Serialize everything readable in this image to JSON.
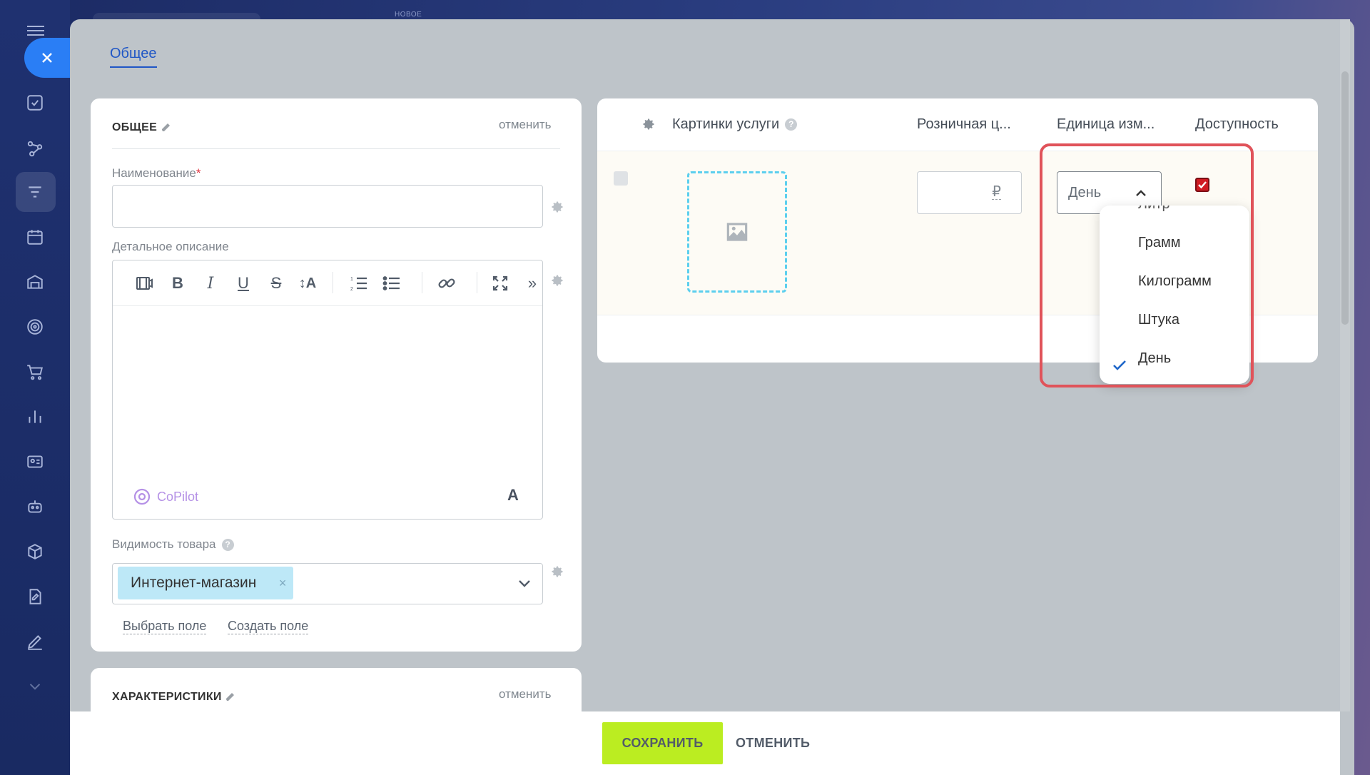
{
  "top": {
    "new_badge": "НОВОЕ"
  },
  "tabs": {
    "general": "Общее"
  },
  "general_section": {
    "title": "ОБЩЕЕ",
    "cancel": "отменить",
    "name_label": "Наименование",
    "name_required_mark": "*",
    "name_value": "",
    "description_label": "Детальное описание",
    "copilot_label": "CoPilot",
    "font_button": "A",
    "visibility_label": "Видимость товара",
    "visibility_help": "?",
    "visibility_tag": "Интернет-магазин",
    "tag_remove": "×",
    "select_field_link": "Выбрать поле",
    "create_field_link": "Создать поле"
  },
  "characteristics_section": {
    "title": "ХАРАКТЕРИСТИКИ",
    "cancel": "отменить"
  },
  "grid": {
    "col_images": "Картинки услуги",
    "col_images_help": "?",
    "col_price": "Розничная ц...",
    "col_unit": "Единица изм...",
    "col_availability": "Доступность",
    "price_value": "",
    "currency": "₽",
    "unit_value": "День",
    "availability_checked": true
  },
  "unit_dropdown": {
    "partial_top": "Литр",
    "options": [
      "Грамм",
      "Килограмм",
      "Штука",
      "День"
    ],
    "selected": "День"
  },
  "footer": {
    "save": "СОХРАНИТЬ",
    "cancel": "ОТМЕНИТЬ"
  },
  "colors": {
    "accent": "#1f56c6",
    "save_button": "#bbed21",
    "tag_bg": "#bde8f7",
    "highlight": "#e0535a",
    "checkbox_checked": "#d01b22",
    "close_button": "#2a7ef5"
  }
}
